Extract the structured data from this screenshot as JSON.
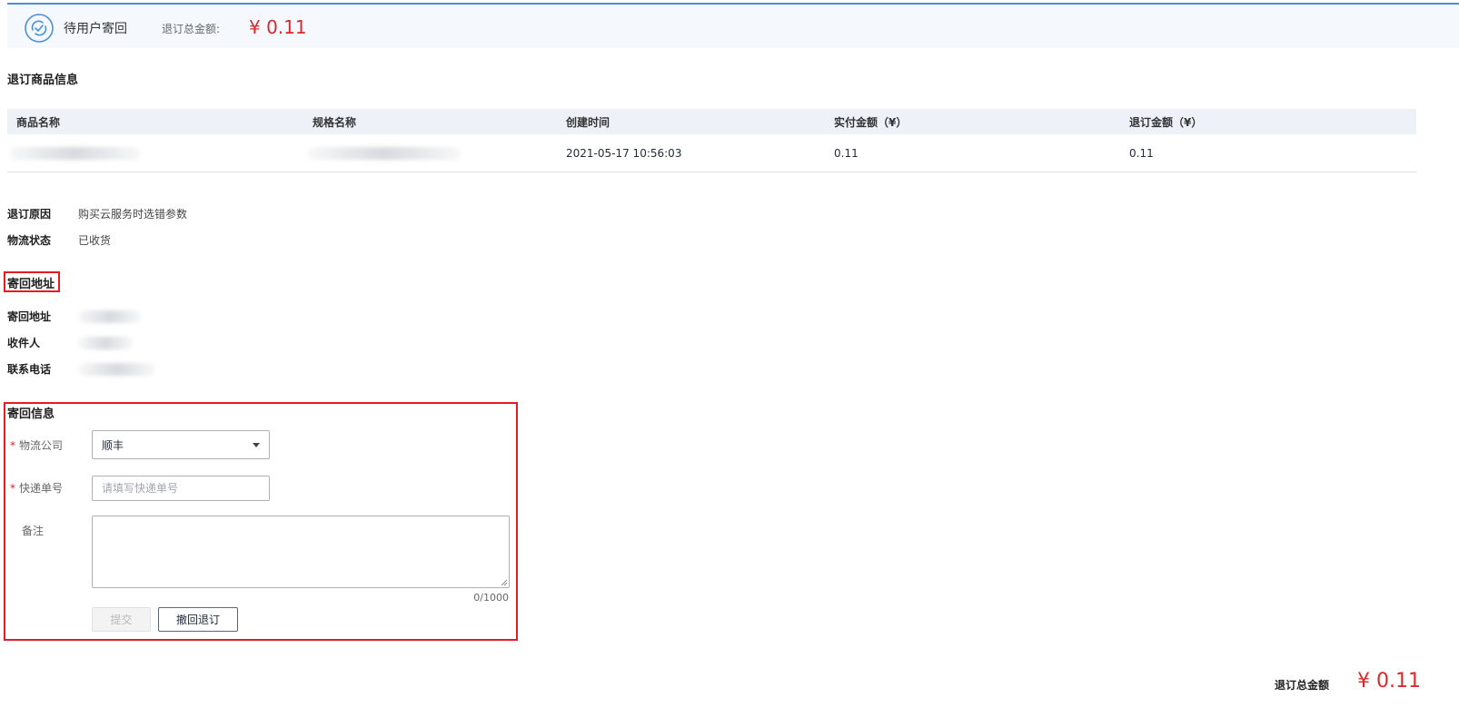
{
  "status": {
    "text": "待用户寄回",
    "amount_label": "退订总金额:",
    "amount": "¥ 0.11",
    "icon": "refresh-check-icon",
    "accent_color": "#4a90d9",
    "amount_color": "#e0262b"
  },
  "products": {
    "title": "退订商品信息",
    "columns": [
      "商品名称",
      "规格名称",
      "创建时间",
      "实付金额（¥）",
      "退订金额（¥）"
    ],
    "rows": [
      {
        "product_name": "",
        "spec_name": "",
        "created_at": "2021-05-17 10:56:03",
        "paid_amount": "0.11",
        "refund_amount": "0.11"
      }
    ]
  },
  "details": {
    "reason_label": "退订原因",
    "reason_value": "购买云服务时选错参数",
    "logistics_label": "物流状态",
    "logistics_value": "已收货"
  },
  "return_address": {
    "title": "寄回地址",
    "address_label": "寄回地址",
    "recipient_label": "收件人",
    "phone_label": "联系电话"
  },
  "return_info": {
    "title": "寄回信息",
    "company_label": "物流公司",
    "company_value": "顺丰",
    "tracking_label": "快递单号",
    "tracking_placeholder": "请填写快递单号",
    "remark_label": "备注",
    "counter": "0/1000",
    "submit_label": "提交",
    "revoke_label": "撤回退订"
  },
  "footer": {
    "label": "退订总金额",
    "amount": "¥ 0.11"
  }
}
